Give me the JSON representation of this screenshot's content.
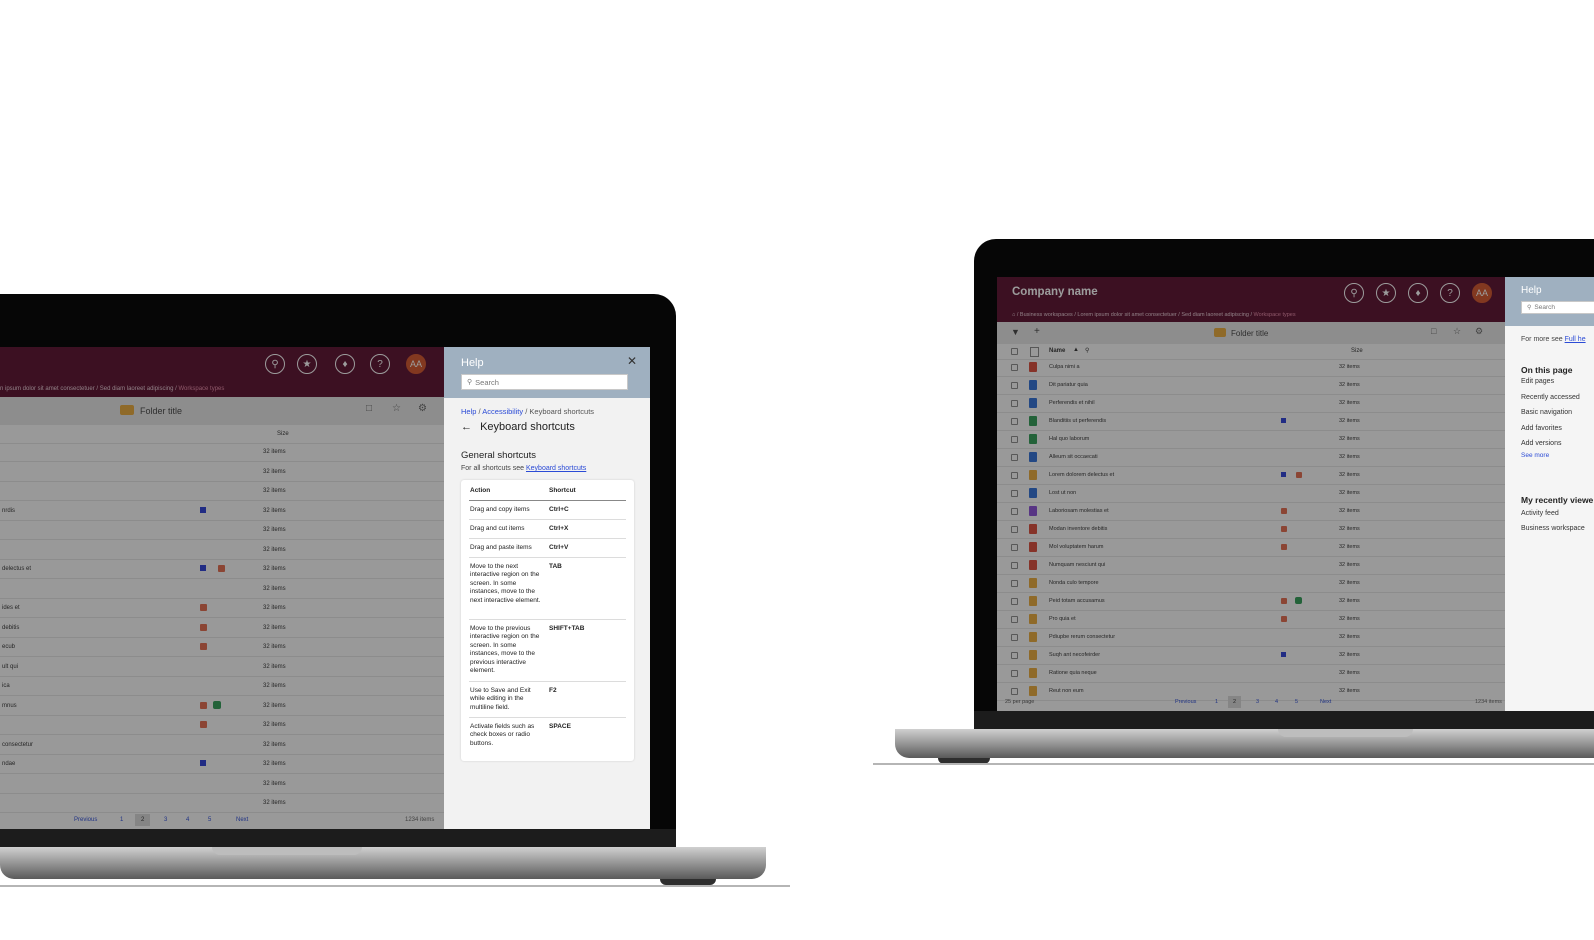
{
  "left": {
    "breadcrumb": {
      "items": [
        "n ipsum dolor sit amet consectetuer",
        "Sed diam laoreet adipiscing"
      ],
      "current": "Workspace types"
    },
    "header_avatar": "AA",
    "toolbar": {
      "folder_title": "Folder title"
    },
    "column_size": "Size",
    "rows": [
      "",
      "",
      "",
      "nrdis",
      "",
      "",
      "delectus et",
      "",
      "ides et",
      "debitis",
      "ecub",
      "ult qui",
      "ica",
      "mnus",
      "",
      "consectetur",
      "ndae",
      "",
      ""
    ],
    "items_label": "32 items",
    "pagination": {
      "prev": "Previous",
      "pages": [
        "1",
        "2",
        "3",
        "4",
        "5"
      ],
      "next": "Next",
      "total": "1234 items"
    },
    "help": {
      "title": "Help",
      "search_placeholder": "Search",
      "breadcrumb": [
        "Help",
        "Accessibility"
      ],
      "breadcrumb_current": "Keyboard shortcuts",
      "page_title": "Keyboard shortcuts",
      "section_title": "General shortcuts",
      "intro": "For all shortcuts see",
      "intro_link": "Keyboard shortcuts",
      "table_headers": {
        "action": "Action",
        "shortcut": "Shortcut"
      },
      "shortcuts": [
        {
          "action": "Drag and copy items",
          "key": "Ctrl+C"
        },
        {
          "action": "Drag and cut items",
          "key": "Ctrl+X"
        },
        {
          "action": "Drag and paste items",
          "key": "Ctrl+V"
        },
        {
          "action": "Move to the next interactive region on the screen. In some instances, move to the next interactive element.",
          "key": "TAB"
        },
        {
          "action": "Move to the previous interactive region on the screen. In some instances, move to the previous interactive element.",
          "key": "SHIFT+TAB"
        },
        {
          "action": "Use to Save and Exit while editing in the multiline field.",
          "key": "F2"
        },
        {
          "action": "Activate fields such as check boxes or radio buttons.",
          "key": "SPACE"
        }
      ]
    }
  },
  "right": {
    "company": "Company name",
    "header_avatar": "AA",
    "breadcrumb": {
      "items": [
        "Business workspaces",
        "Lorem ipsum dolor sit amet consectetuer",
        "Sed diam laoreet adipiscing"
      ],
      "current": "Workspace types"
    },
    "toolbar": {
      "folder_title": "Folder title"
    },
    "columns": {
      "name": "Name",
      "size": "Size"
    },
    "rows": [
      "Culpa nimi a",
      "Dit pariatur quia",
      "Perferendis et nihil",
      "Blanditiis ut perferendis",
      "Hal quo laborum",
      "Alleum sit occaecati",
      "Lorem dolorem delectus et",
      "Lost ut non",
      "Laboriosam molestias et",
      "Modan inventore debitis",
      "Mol voluptatem harum",
      "Numquam nesciunt qui",
      "Nonda culo tempore",
      "Peid totam accusamus",
      "Pro quia et",
      "Pdiupbe rerum consectetur",
      "Suqh ant necofeirder",
      "Ratione quia neque",
      "Reut non eum"
    ],
    "items_label": "32 items",
    "pagination": {
      "per_page": "25 per page",
      "prev": "Previous",
      "pages": [
        "1",
        "2",
        "3",
        "4",
        "5"
      ],
      "next": "Next",
      "total": "1234 items"
    },
    "help": {
      "title": "Help",
      "search_placeholder": "Search",
      "more_text": "For more see",
      "more_link": "Full he",
      "on_this_page_title": "On this page",
      "on_this_page": [
        "Edit pages",
        "Recently accessed",
        "Basic navigation",
        "Add favorites",
        "Add versions"
      ],
      "see_more": "See more",
      "recent_title": "My recently viewe",
      "recent": [
        "Activity feed",
        "Business workspace"
      ]
    }
  },
  "colors": {
    "brand": "#5a0f2e",
    "avatar": "#d2532a",
    "link": "#2b4bd6",
    "help_header": "#9fb0c0"
  }
}
